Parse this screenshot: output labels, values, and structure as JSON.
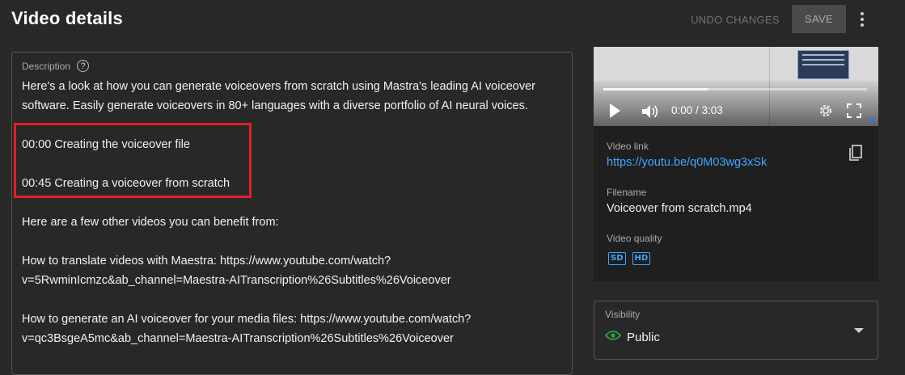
{
  "header": {
    "title": "Video details",
    "undo_label": "UNDO CHANGES",
    "save_label": "SAVE"
  },
  "description": {
    "label": "Description",
    "help_icon": "?",
    "paragraphs": [
      "Here's a look at how you can generate voiceovers from scratch using Mastra's leading AI voiceover",
      "software. Easily generate voiceovers in 80+ languages with a diverse portfolio of AI neural voices.",
      "",
      "00:00 Creating the voiceover file",
      "",
      "00:45 Creating a voiceover from scratch",
      "",
      "Here are a few other videos you can benefit from:",
      "",
      "How to translate videos with Maestra: https://www.youtube.com/watch?",
      "v=5RwminIcmzc&ab_channel=Maestra-AITranscription%26Subtitles%26Voiceover",
      "",
      "How to generate an AI voiceover for your media files: https://www.youtube.com/watch?",
      "v=qc3BsgeA5mc&ab_channel=Maestra-AITranscription%26Subtitles%26Voiceover"
    ]
  },
  "video": {
    "time": "0:00 / 3:03",
    "progress": 0.4,
    "link_label": "Video link",
    "link": "https://youtu.be/q0M03wg3xSk",
    "filename_label": "Filename",
    "filename": "Voiceover from scratch.mp4",
    "quality_label": "Video quality",
    "quality_badges": [
      "SD",
      "HD"
    ],
    "accent_color": "#3ea6ff"
  },
  "visibility": {
    "label": "Visibility",
    "value": "Public",
    "status_color": "#2ba640"
  },
  "icons": {
    "help": "help-circle-icon",
    "more": "more-vert-icon",
    "play": "play-icon",
    "volume": "volume-icon",
    "settings": "gear-icon",
    "fullscreen": "fullscreen-icon",
    "copy": "copy-icon",
    "visibility": "eye-icon",
    "dropdown": "caret-down-icon"
  },
  "highlight_color": "#e0202b"
}
